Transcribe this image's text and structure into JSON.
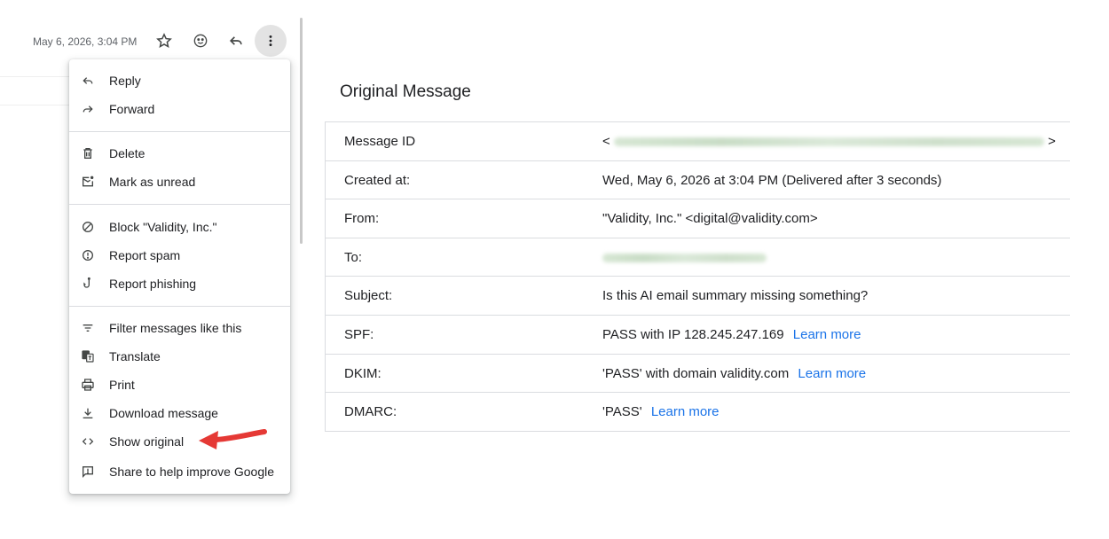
{
  "header": {
    "date": "May 6, 2026, 3:04 PM",
    "icons": [
      "star-icon",
      "emoji-icon",
      "reply-icon",
      "more-vert-icon"
    ]
  },
  "menu": {
    "items": [
      {
        "label": "Reply",
        "icon": "reply-icon"
      },
      {
        "label": "Forward",
        "icon": "forward-icon"
      },
      {
        "label": "Delete",
        "icon": "trash-icon"
      },
      {
        "label": "Mark as unread",
        "icon": "mark-unread-icon"
      },
      {
        "label": "Block \"Validity, Inc.\"",
        "icon": "block-icon"
      },
      {
        "label": "Report spam",
        "icon": "report-spam-icon"
      },
      {
        "label": "Report phishing",
        "icon": "phishing-icon"
      },
      {
        "label": "Filter messages like this",
        "icon": "filter-icon"
      },
      {
        "label": "Translate",
        "icon": "translate-icon"
      },
      {
        "label": "Print",
        "icon": "print-icon"
      },
      {
        "label": "Download message",
        "icon": "download-icon"
      },
      {
        "label": "Show original",
        "icon": "code-icon"
      },
      {
        "label": "Share to help improve Google",
        "icon": "feedback-icon"
      }
    ]
  },
  "annotation": {
    "arrow_color": "#e53935"
  },
  "original_message": {
    "title": "Original Message",
    "rows": [
      {
        "label": "Message ID",
        "value_prefix": "<",
        "value_suffix": ">",
        "link": ""
      },
      {
        "label": "Created at:",
        "value": "Wed, May 6, 2026 at 3:04 PM (Delivered after 3 seconds)",
        "link": ""
      },
      {
        "label": "From:",
        "value": "\"Validity, Inc.\" <digital@validity.com>",
        "link": ""
      },
      {
        "label": "To:",
        "value": "",
        "link": ""
      },
      {
        "label": "Subject:",
        "value": "Is this AI email summary missing something?",
        "link": ""
      },
      {
        "label": "SPF:",
        "value": "PASS with IP 128.245.247.169",
        "link": "Learn more"
      },
      {
        "label": "DKIM:",
        "value": "'PASS' with domain validity.com",
        "link": "Learn more"
      },
      {
        "label": "DMARC:",
        "value": "'PASS'",
        "link": "Learn more"
      }
    ]
  },
  "colors": {
    "link": "#1a73e8",
    "text": "#202124",
    "icon": "#444746",
    "border": "#dadce0"
  }
}
